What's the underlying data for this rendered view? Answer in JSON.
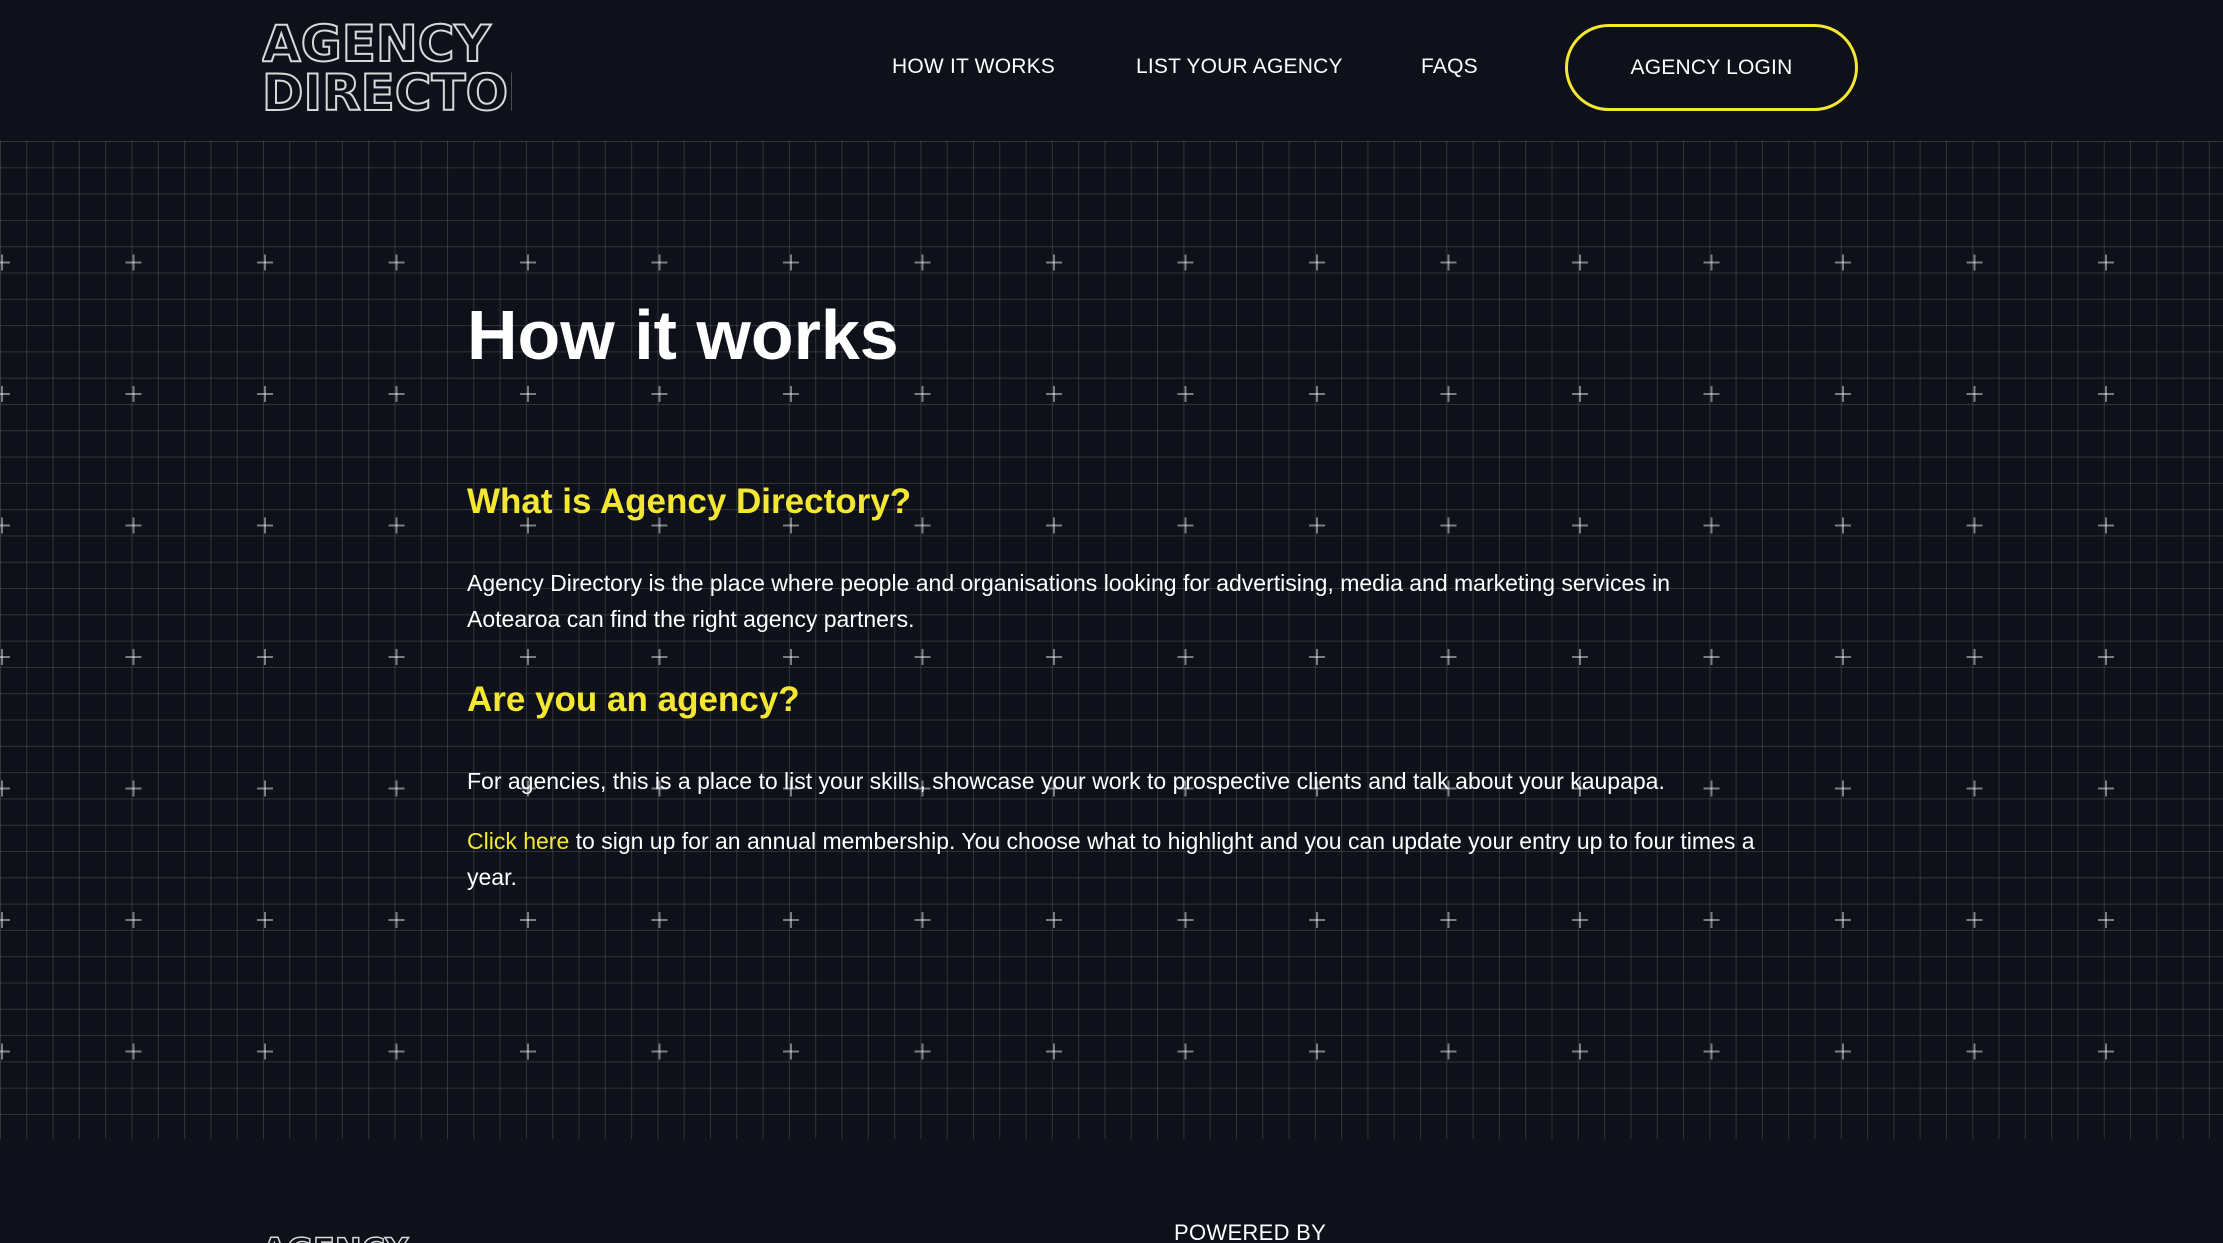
{
  "header": {
    "logo_line1": "AGENCY",
    "logo_line2": "DIRECTORY",
    "nav": [
      {
        "label": "HOW IT WORKS"
      },
      {
        "label": "LIST YOUR AGENCY"
      },
      {
        "label": "FAQS"
      }
    ],
    "login_label": "AGENCY LOGIN"
  },
  "main": {
    "title": "How it works",
    "sections": [
      {
        "heading": "What is Agency Directory?",
        "body": "Agency Directory is the place where people and organisations looking for advertising, media and marketing services in Aotearoa can find the right agency partners."
      },
      {
        "heading": "Are you an agency?",
        "body": "For agencies, this is a place to list your skills, showcase your work to prospective clients and talk about your kaupapa.",
        "cta_link": "Click here",
        "cta_rest": " to sign up for an annual membership. You choose what to highlight and you can update your entry up to four times a year."
      }
    ]
  },
  "footer": {
    "logo_line1": "AGENCY",
    "powered_by": "POWERED BY"
  },
  "colors": {
    "background": "#0f111a",
    "accent_yellow": "#f3e733",
    "text": "#ffffff",
    "grid_line": "rgba(255,255,255,0.14)"
  }
}
